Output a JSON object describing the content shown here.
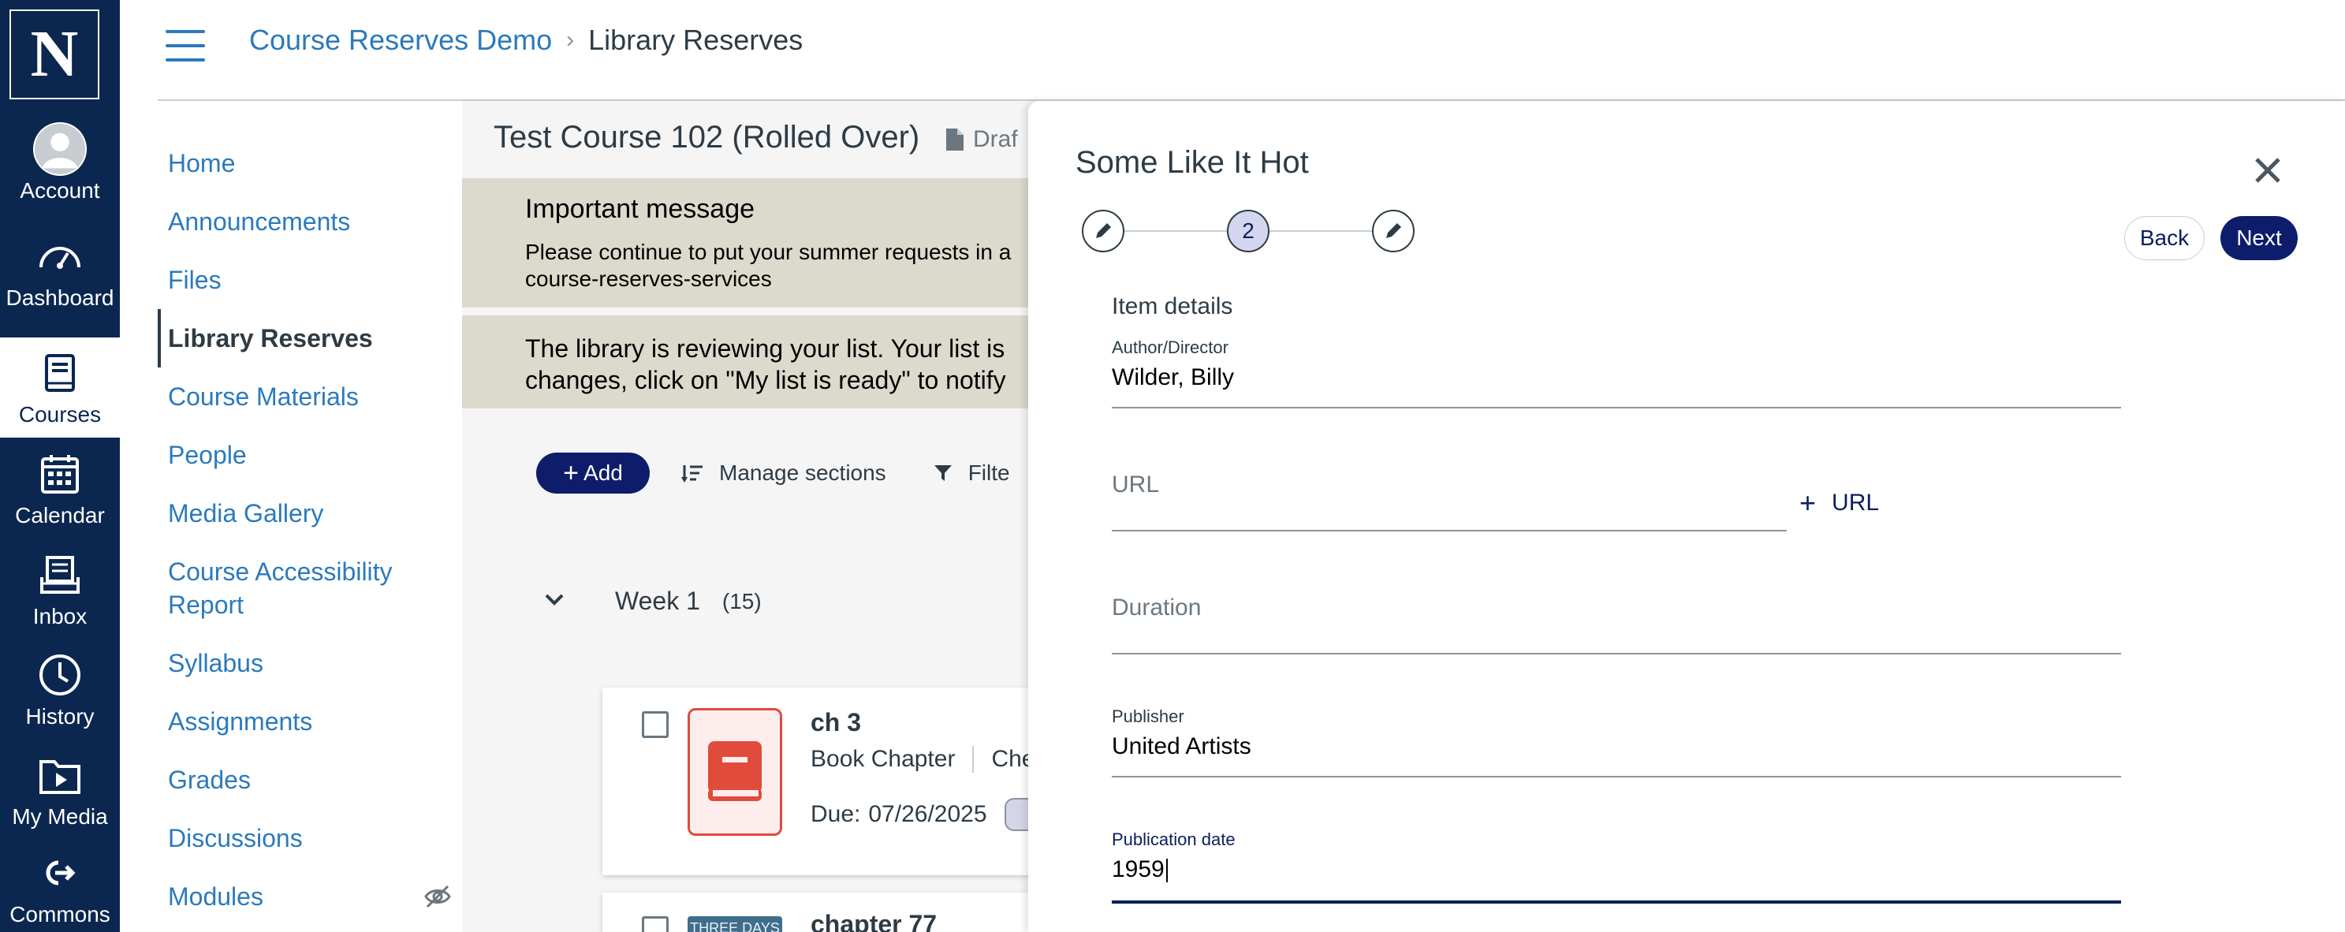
{
  "global_nav": {
    "logo_letter": "N",
    "items": [
      {
        "label": "Account",
        "icon": "account-icon"
      },
      {
        "label": "Dashboard",
        "icon": "dashboard-icon"
      },
      {
        "label": "Courses",
        "icon": "courses-icon",
        "active": true
      },
      {
        "label": "Calendar",
        "icon": "calendar-icon"
      },
      {
        "label": "Inbox",
        "icon": "inbox-icon"
      },
      {
        "label": "History",
        "icon": "history-icon"
      },
      {
        "label": "My Media",
        "icon": "my-media-icon"
      },
      {
        "label": "Commons",
        "icon": "commons-icon"
      }
    ]
  },
  "breadcrumb": {
    "course": "Course Reserves Demo",
    "separator": "›",
    "current": "Library Reserves"
  },
  "course_nav": {
    "items": [
      {
        "label": "Home"
      },
      {
        "label": "Announcements"
      },
      {
        "label": "Files"
      },
      {
        "label": "Library Reserves",
        "active": true
      },
      {
        "label": "Course Materials"
      },
      {
        "label": "People"
      },
      {
        "label": "Media Gallery"
      },
      {
        "label": "Course Accessibility Report"
      },
      {
        "label": "Syllabus"
      },
      {
        "label": "Assignments"
      },
      {
        "label": "Grades"
      },
      {
        "label": "Discussions"
      },
      {
        "label": "Modules",
        "hidden_icon": "eye-slash-icon"
      }
    ]
  },
  "main": {
    "course_title": "Test Course 102 (Rolled Over)",
    "status": "Draf",
    "banner1": {
      "title": "Important message",
      "body": "Please continue to put your summer requests in a\ncourse-reserves-services"
    },
    "banner2": {
      "body": "The library is reviewing your list. Your list is\nchanges, click on \"My list is ready\" to notify"
    },
    "toolbar": {
      "add_label": "Add",
      "manage_label": "Manage sections",
      "filter_label": "Filte"
    },
    "week": {
      "label": "Week 1",
      "count": "(15)"
    },
    "items": [
      {
        "title": "ch 3",
        "type": "Book Chapter",
        "extra": "Cher",
        "due_label": "Due:",
        "due_date": "07/26/2025"
      },
      {
        "title": "chapter 77",
        "thumb_text": "THREE DAYS"
      }
    ]
  },
  "drawer": {
    "title": "Some Like It Hot",
    "current_step": "2",
    "back_label": "Back",
    "next_label": "Next",
    "section_label": "Item details",
    "fields": {
      "author": {
        "label": "Author/Director",
        "value": "Wilder, Billy"
      },
      "url": {
        "placeholder": "URL"
      },
      "add_url_label": "URL",
      "duration": {
        "placeholder": "Duration"
      },
      "publisher": {
        "label": "Publisher",
        "value": "United Artists"
      },
      "pub_date": {
        "label": "Publication date",
        "value": "1959"
      }
    }
  },
  "colors": {
    "global_nav_bg": "#0b2750",
    "link_blue": "#2b7abc",
    "primary_button": "#0d1d6b",
    "banner_bg": "#dcd9cd",
    "chapter_icon": "#e14b3b"
  }
}
